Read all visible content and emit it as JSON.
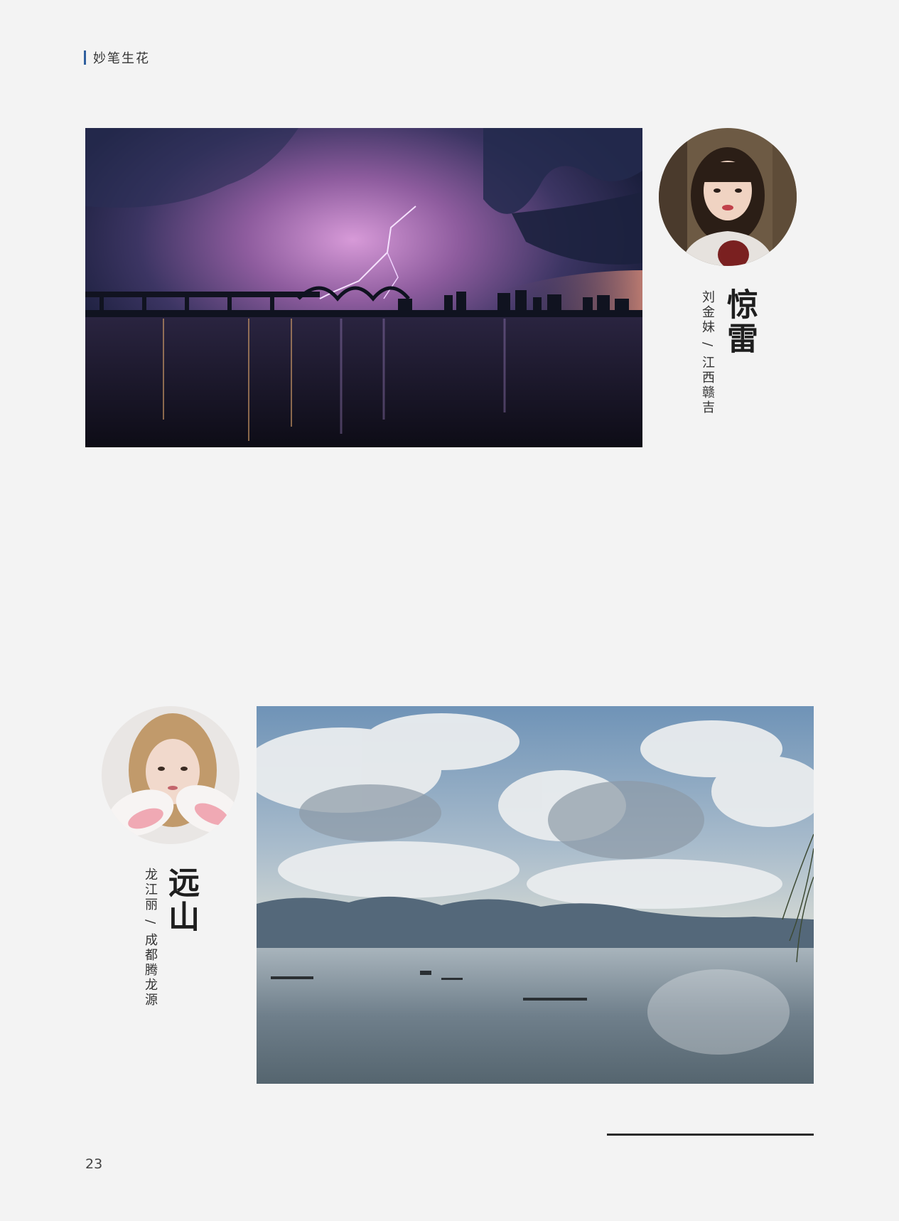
{
  "header": {
    "section_title": "妙笔生花"
  },
  "entries": [
    {
      "title": "惊雷",
      "author": "刘金妹",
      "separator": "/",
      "location": "江西赣吉"
    },
    {
      "title": "远山",
      "author": "龙江丽",
      "separator": "/",
      "location": "成都腾龙源"
    }
  ],
  "footer": {
    "page_number": "23"
  },
  "colors": {
    "accent_bar": "#2f5f9e",
    "background": "#f3f3f3",
    "rule": "#2a2a2a"
  }
}
